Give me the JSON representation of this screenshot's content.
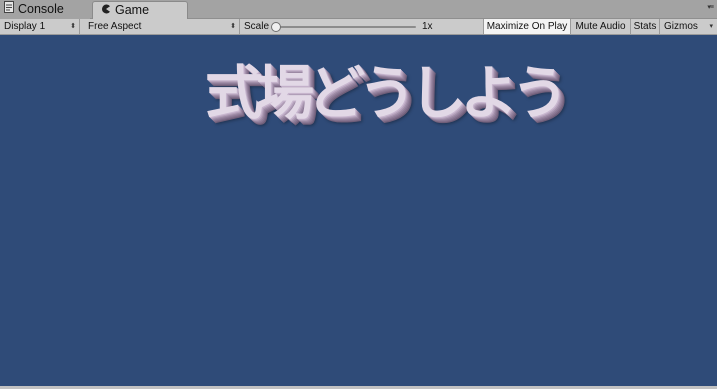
{
  "tabs": [
    {
      "label": "Console",
      "icon": "console-icon",
      "active": false
    },
    {
      "label": "Game",
      "icon": "pacman-icon",
      "active": true
    }
  ],
  "toolbar": {
    "display_select": "Display 1",
    "aspect_select": "Free Aspect",
    "scale_label": "Scale",
    "scale_value": "1x",
    "scale_level": 0.0,
    "maximize_on_play": "Maximize On Play",
    "mute_audio": "Mute Audio",
    "stats": "Stats",
    "gizmos": "Gizmos",
    "maximize_on_play_enabled": true
  },
  "game_view": {
    "background_color": "#2f4b78",
    "text3d": "式場どうしよう"
  }
}
